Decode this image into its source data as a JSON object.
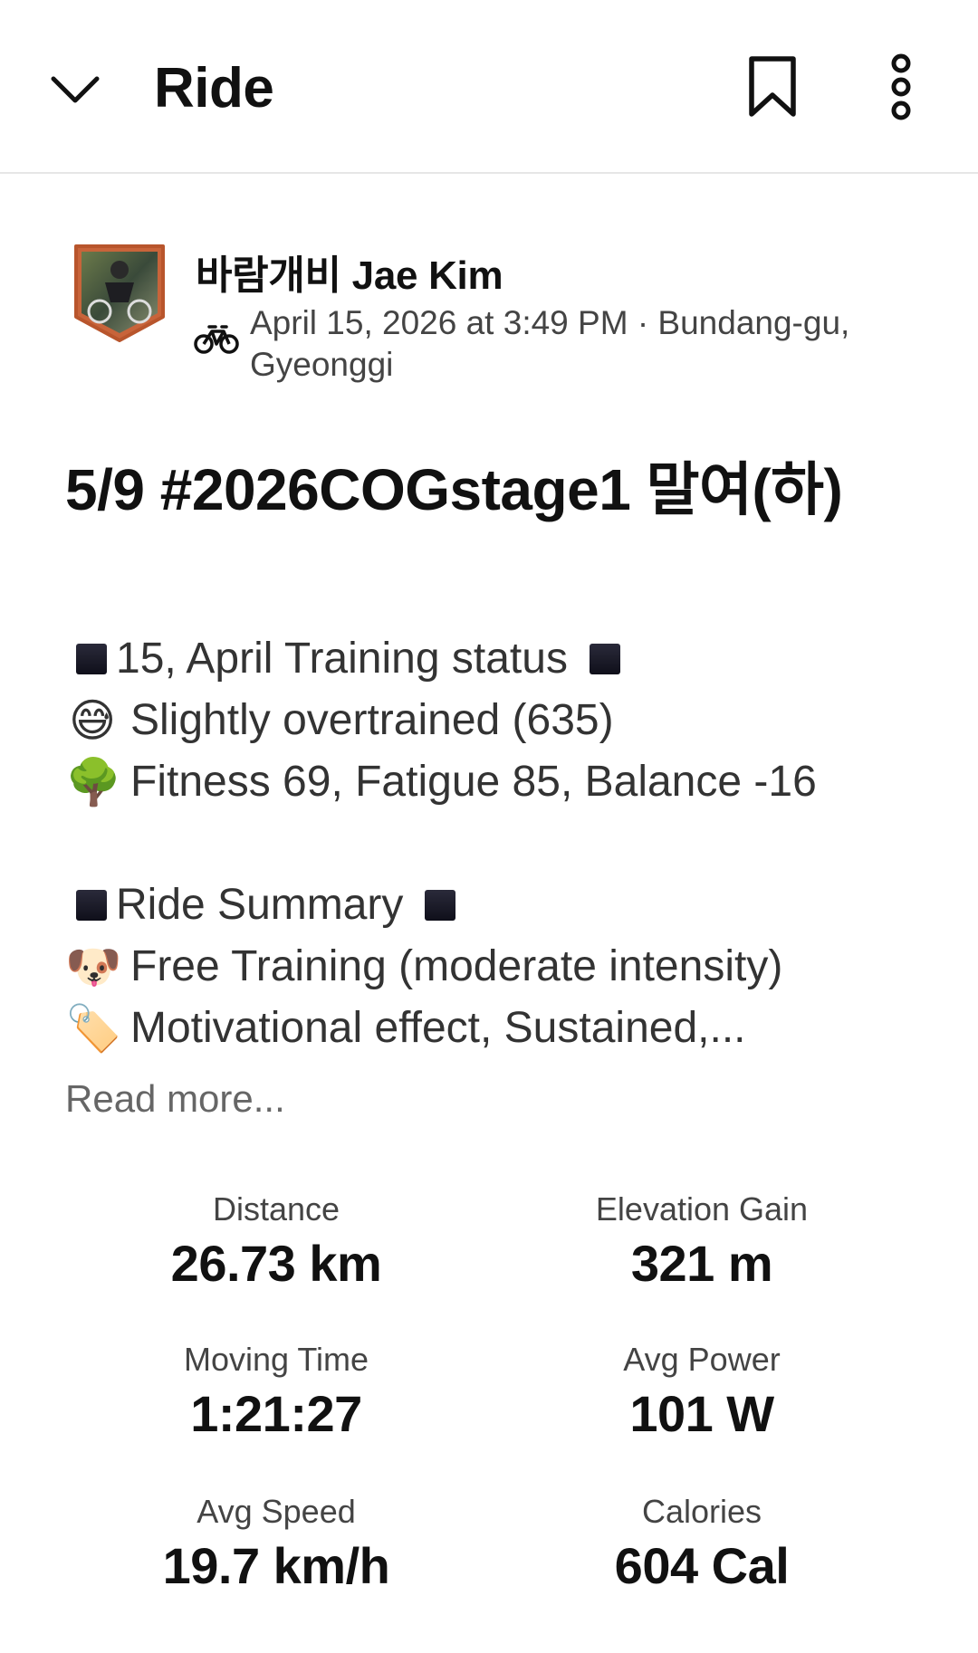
{
  "header": {
    "title": "Ride",
    "back_icon": "chevron-down-icon",
    "bookmark_icon": "bookmark-icon",
    "more_icon": "more-vertical-icon"
  },
  "athlete": {
    "name": "바람개비 Jae Kim",
    "activity_icon": "bicycle-icon",
    "meta": "April 15, 2026 at 3:49 PM · Bundang-gu, Gyeonggi"
  },
  "activity": {
    "title": "5/9 #2026COGstage1 말여(하)"
  },
  "description": {
    "lines": [
      {
        "prefix": "■",
        "text": "15, April Training status",
        "suffix": "■"
      },
      {
        "emoji": "😅",
        "text": "Slightly overtrained (635)"
      },
      {
        "emoji": "🌳",
        "text": "Fitness 69, Fatigue 85, Balance -16"
      },
      {
        "prefix": "■",
        "text": "Ride Summary",
        "suffix": "■"
      },
      {
        "emoji": "🐶",
        "text": "Free Training (moderate intensity)"
      },
      {
        "emoji": "🏷️",
        "text": "Motivational effect, Sustained,..."
      }
    ],
    "read_more": "Read more..."
  },
  "stats": [
    {
      "label": "Distance",
      "value": "26.73 km"
    },
    {
      "label": "Elevation Gain",
      "value": "321 m"
    },
    {
      "label": "Moving Time",
      "value": "1:21:27"
    },
    {
      "label": "Avg Power",
      "value": "101 W"
    },
    {
      "label": "Avg Speed",
      "value": "19.7 km/h"
    },
    {
      "label": "Calories",
      "value": "604 Cal"
    }
  ]
}
